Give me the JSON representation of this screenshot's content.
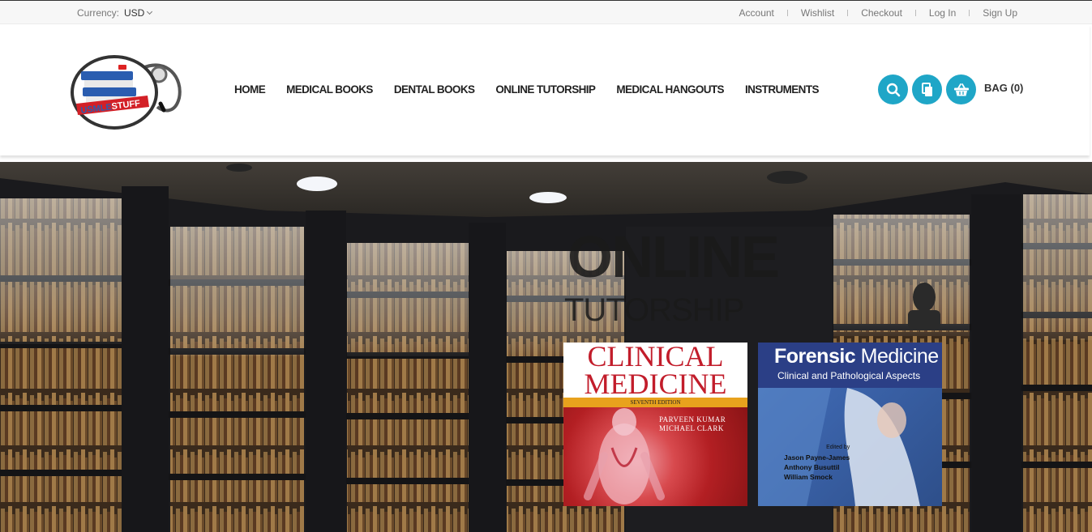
{
  "topbar": {
    "currency_label": "Currency:",
    "currency_value": "USD",
    "links": [
      "Account",
      "Wishlist",
      "Checkout",
      "Log In",
      "Sign Up"
    ]
  },
  "header": {
    "logo_text": "USMLESTUFF",
    "nav": [
      "HOME",
      "MEDICAL BOOKS",
      "DENTAL BOOKS",
      "ONLINE TUTORSHIP",
      "MEDICAL HANGOUTS",
      "INSTRUMENTS"
    ],
    "icons": [
      "search-icon",
      "compare-icon",
      "basket-icon"
    ],
    "bag_label": "BAG (0)",
    "accent": "#1fa6c7"
  },
  "hero": {
    "title_line1": "ONLINE",
    "title_line2": "TUTORSHIP",
    "book1": {
      "title_line1": "CLINICAL",
      "title_line2": "MEDICINE",
      "edition": "SEVENTH EDITION",
      "authors": [
        "PARVEEN KUMAR",
        "MICHAEL CLARK"
      ]
    },
    "book2": {
      "title_a": "Forensic",
      "title_b": "Medicine",
      "subtitle": "Clinical and Pathological Aspects",
      "edited_by": "Edited by",
      "authors": [
        "Jason Payne-James",
        "Anthony Busuttil",
        "William Smock"
      ]
    }
  }
}
